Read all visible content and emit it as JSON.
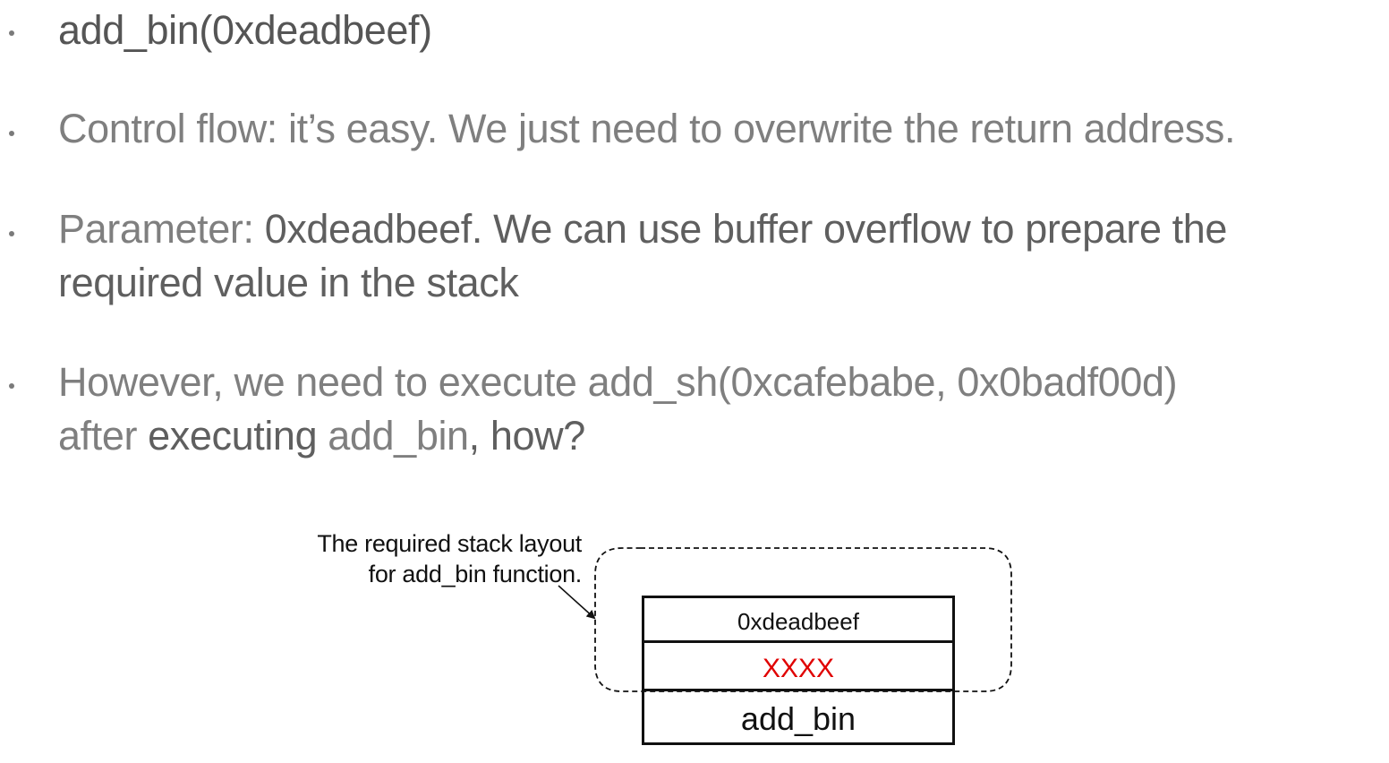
{
  "bullets": [
    {
      "lines": [
        [
          {
            "text": "add_bin(0xdeadbeef)",
            "style": "hdr"
          }
        ]
      ]
    },
    {
      "lines": [
        [
          {
            "text": "Control flow: it’s easy. We just need to overwrite the return address.",
            "style": "normal"
          }
        ]
      ]
    },
    {
      "lines": [
        [
          {
            "text": "Parameter: ",
            "style": "normal"
          },
          {
            "text": "0xdeadbeef. We can use buffer overflow to prepare the",
            "style": "bold"
          }
        ],
        [
          {
            "text": "required value in the stack",
            "style": "bold"
          }
        ]
      ]
    },
    {
      "lines": [
        [
          {
            "text": "However, we need to execute add_sh(0xcafebabe, 0x0badf00d)",
            "style": "normal"
          }
        ],
        [
          {
            "text": "after ",
            "style": "normal"
          },
          {
            "text": "executing",
            "style": "bold"
          },
          {
            "text": " add_bin",
            "style": "normal"
          },
          {
            "text": ", how?",
            "style": "bold"
          }
        ]
      ]
    }
  ],
  "diagram": {
    "caption_line1": "The required stack layout",
    "caption_line2": "for add_bin function.",
    "cells": [
      {
        "label": "0xdeadbeef",
        "color": "#111111"
      },
      {
        "label": "XXXX",
        "color": "#e00000"
      },
      {
        "label": "add_bin",
        "color": "#111111"
      }
    ]
  }
}
